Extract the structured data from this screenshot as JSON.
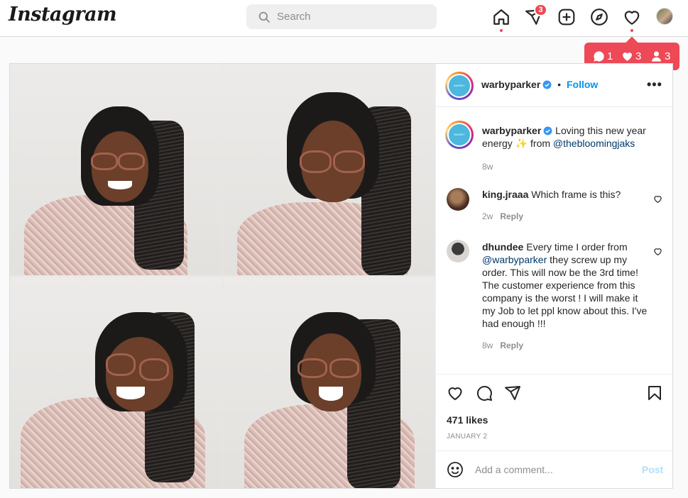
{
  "brand": {
    "logo": "Instagram"
  },
  "search": {
    "placeholder": "Search"
  },
  "nav": {
    "messages_badge": "3"
  },
  "activity_popup": {
    "comments": "1",
    "likes": "3",
    "follows": "3"
  },
  "post": {
    "header": {
      "username": "warbyparker",
      "separator": "•",
      "follow_label": "Follow",
      "more_label": "•••",
      "avatar_text": "WARBY PARKER"
    },
    "caption": {
      "username": "warbyparker",
      "text_before": "Loving this new year energy ✨ from ",
      "mention": "@thebloomingjaks",
      "time": "8w"
    },
    "comments": [
      {
        "username": "king.jraaa",
        "text": "Which frame is this?",
        "time": "2w",
        "reply_label": "Reply"
      },
      {
        "username": "dhundee",
        "mention": "@warbyparker",
        "text_before": "Every time I order from ",
        "text_after": " they screw up my order. This will now be the 3rd time! The customer experience from this company is the worst ! I will make it my Job to let ppl know about this. I've had enough !!!",
        "time": "8w",
        "reply_label": "Reply"
      }
    ],
    "likes": "471 likes",
    "date": "JANUARY 2",
    "add_comment_placeholder": "Add a comment...",
    "post_label": "Post"
  }
}
